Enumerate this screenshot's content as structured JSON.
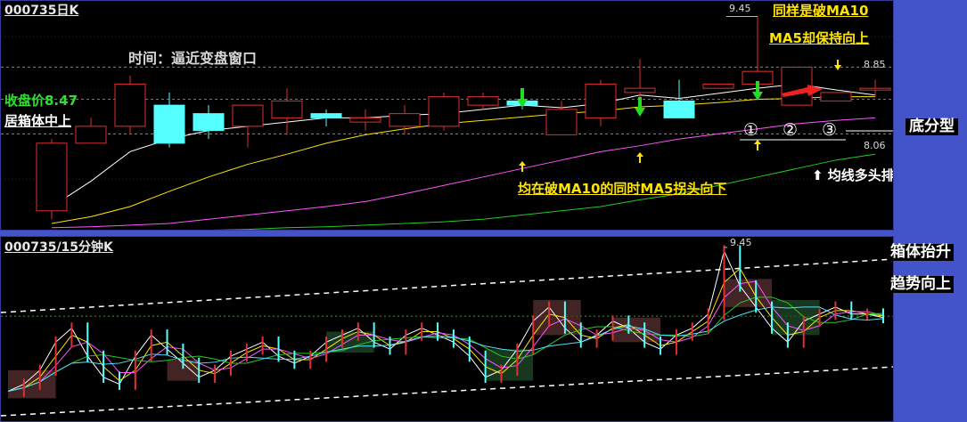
{
  "top_chart": {
    "code_title": "000735日K",
    "price_high": "9.45",
    "level_upper": "8.85",
    "level_lower": "8.06",
    "ann_time": "时间：逼近变盘窗口",
    "ann_close": "收盘价8.47",
    "ann_box": "居箱体中上",
    "ann_same": "同样是破MA10",
    "ann_ma5": "MA5却保持向上",
    "ann_bottom": "底分型",
    "ann_ma5_turn": "均在破MA10的同时MA5拐头向下",
    "ann_ma_long": "⬆ 均线多头排列不改",
    "circles": [
      "①",
      "②",
      "③"
    ]
  },
  "bottom_chart": {
    "code_title": "000735/15分钟K",
    "price_high": "9.45",
    "ann_box_rise": "箱体抬升",
    "ann_trend_up": "趋势向上"
  },
  "colors": {
    "up_candle": "#e03030",
    "down_candle": "#55ffff",
    "ma5": "#ffffff",
    "ma10": "#ffe400",
    "ma20": "#ff55ff",
    "ma60": "#22cc22",
    "panel_border": "#4353c9",
    "annotation_yellow": "#ffe400"
  },
  "chart_data": [
    {
      "type": "candlestick",
      "title": "000735日K",
      "ylim": [
        7.0,
        9.55
      ],
      "reference_levels": [
        8.85,
        8.47,
        8.06
      ],
      "ohlc": [
        [
          7.15,
          8.0,
          7.05,
          7.95
        ],
        [
          7.95,
          8.25,
          7.95,
          8.15
        ],
        [
          8.15,
          8.75,
          8.05,
          8.65
        ],
        [
          8.4,
          8.55,
          7.9,
          7.95
        ],
        [
          8.3,
          8.4,
          8.0,
          8.1
        ],
        [
          8.15,
          8.25,
          7.9,
          8.4
        ],
        [
          8.25,
          8.6,
          8.05,
          8.45
        ],
        [
          8.3,
          8.35,
          8.15,
          8.25
        ],
        [
          8.2,
          8.35,
          8.1,
          8.25
        ],
        [
          8.15,
          8.4,
          8.05,
          8.3
        ],
        [
          8.15,
          8.55,
          8.1,
          8.5
        ],
        [
          8.4,
          8.55,
          8.35,
          8.5
        ],
        [
          8.45,
          8.6,
          8.35,
          8.4
        ],
        [
          8.05,
          8.45,
          8.05,
          8.35
        ],
        [
          8.25,
          8.7,
          8.15,
          8.65
        ],
        [
          8.55,
          8.95,
          8.45,
          8.6
        ],
        [
          8.45,
          8.7,
          8.25,
          8.25
        ],
        [
          8.6,
          8.65,
          8.6,
          8.65
        ],
        [
          8.65,
          9.45,
          8.65,
          8.8
        ],
        [
          8.4,
          8.85,
          8.4,
          8.85
        ],
        [
          8.45,
          8.55,
          8.45,
          8.55
        ],
        [
          8.6,
          8.7,
          8.5,
          8.6
        ]
      ],
      "series": [
        {
          "name": "MA5",
          "values": [
            7.2,
            7.5,
            7.85,
            8.0,
            8.1,
            8.15,
            8.2,
            8.25,
            8.25,
            8.28,
            8.3,
            8.35,
            8.4,
            8.37,
            8.42,
            8.52,
            8.48,
            8.54,
            8.6,
            8.65,
            8.58,
            8.52
          ]
        },
        {
          "name": "MA10",
          "values": [
            7.0,
            7.08,
            7.2,
            7.38,
            7.55,
            7.7,
            7.82,
            7.95,
            8.05,
            8.12,
            8.18,
            8.22,
            8.26,
            8.3,
            8.33,
            8.38,
            8.4,
            8.43,
            8.47,
            8.48,
            8.5,
            8.5
          ]
        },
        {
          "name": "MA20",
          "values": [
            6.95,
            6.96,
            6.98,
            7.0,
            7.05,
            7.1,
            7.15,
            7.2,
            7.26,
            7.35,
            7.45,
            7.55,
            7.65,
            7.75,
            7.85,
            7.92,
            8.0,
            8.06,
            8.12,
            8.18,
            8.22,
            8.25
          ]
        },
        {
          "name": "MA60",
          "values": [
            6.9,
            6.9,
            6.9,
            6.9,
            6.92,
            6.93,
            6.95,
            6.96,
            6.98,
            7.0,
            7.02,
            7.05,
            7.1,
            7.15,
            7.2,
            7.28,
            7.35,
            7.45,
            7.55,
            7.65,
            7.75,
            7.82
          ]
        }
      ]
    },
    {
      "type": "line",
      "title": "000735/15分钟K",
      "ylim": [
        7.0,
        9.55
      ],
      "series": [
        {
          "name": "close",
          "values": [
            7.4,
            7.5,
            7.7,
            8.1,
            8.3,
            7.9,
            7.6,
            7.5,
            7.9,
            8.2,
            8.0,
            7.8,
            7.6,
            7.7,
            7.9,
            8.0,
            8.1,
            7.9,
            7.8,
            7.9,
            8.1,
            8.2,
            8.3,
            8.1,
            8.0,
            8.2,
            8.3,
            8.2,
            8.1,
            7.9,
            7.6,
            7.7,
            8.0,
            8.4,
            8.6,
            8.3,
            8.1,
            8.2,
            8.4,
            8.3,
            8.1,
            8.0,
            8.2,
            8.3,
            8.5,
            9.4,
            8.9,
            8.6,
            8.3,
            8.1,
            8.4,
            8.5,
            8.6,
            8.5,
            8.5,
            8.45
          ]
        }
      ]
    }
  ]
}
